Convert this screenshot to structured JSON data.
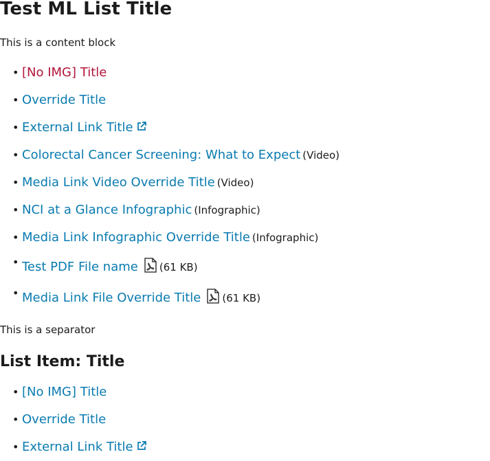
{
  "page_title": "Test ML List Title",
  "content_block": "This is a content block",
  "list1": [
    {
      "title": "[No IMG] Title",
      "visited": true
    },
    {
      "title": "Override Title"
    },
    {
      "title": "External Link Title",
      "external": true
    },
    {
      "title": "Colorectal Cancer Screening: What to Expect",
      "meta": "(Video)"
    },
    {
      "title": "Media Link Video Override Title",
      "meta": "(Video)"
    },
    {
      "title": "NCI at a Glance Infographic",
      "meta": "(Infographic)"
    },
    {
      "title": "Media Link Infographic Override Title",
      "meta": "(Infographic)"
    },
    {
      "title": "Test PDF File name",
      "pdf": true,
      "meta": "(61 KB)"
    },
    {
      "title": "Media Link File Override Title",
      "pdf": true,
      "meta": "(61 KB)"
    }
  ],
  "separator": "This is a separator",
  "list_title_2": "List Item: Title",
  "list2": [
    {
      "title": "[No IMG] Title"
    },
    {
      "title": "Override Title"
    },
    {
      "title": "External Link Title",
      "external": true
    }
  ],
  "colors": {
    "link": "#0a7bb0",
    "visited_link": "#b2153a",
    "text": "#1b1b1b"
  },
  "bullet": "•"
}
